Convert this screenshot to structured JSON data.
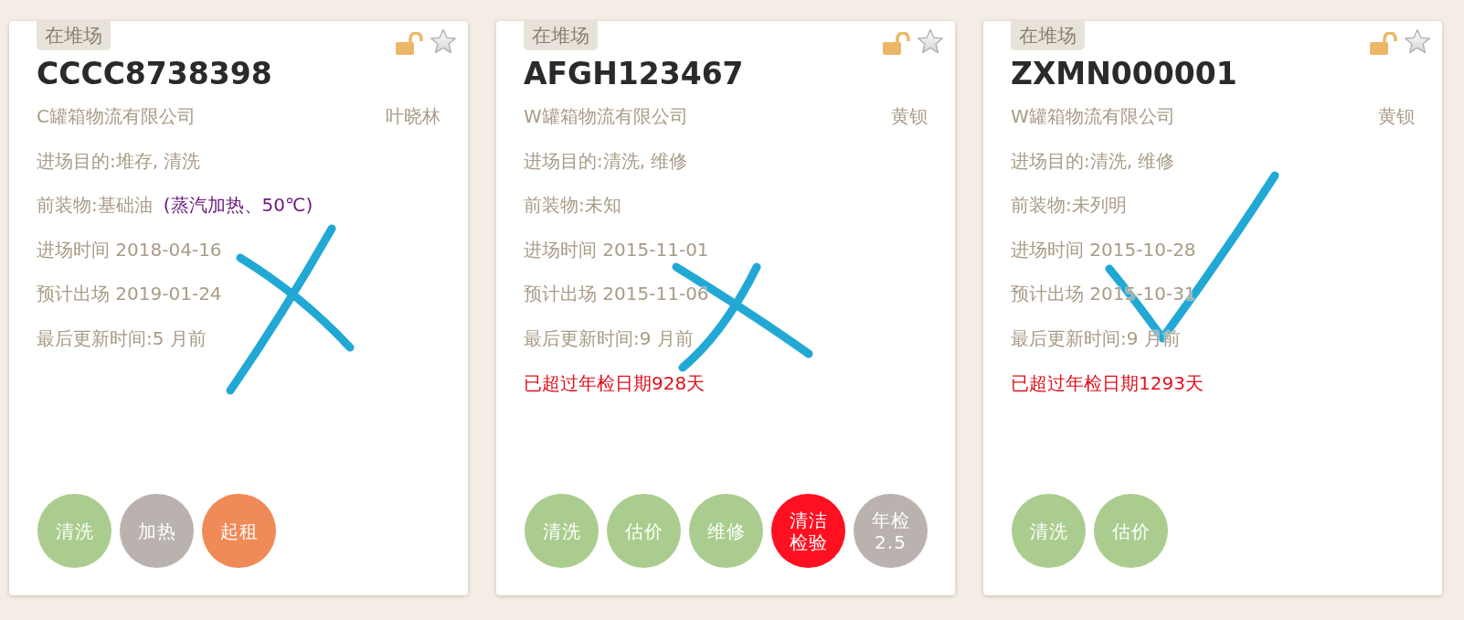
{
  "cards": [
    {
      "status": "在堆场",
      "container_no": "CCCC8738398",
      "company": "C罐箱物流有限公司",
      "contact": "叶晓林",
      "purpose": "进场目的:堆存, 清洗",
      "cargo": {
        "text": "前装物:基础油",
        "note": "(蒸汽加热、50℃)"
      },
      "entry": "进场时间 2018-04-16",
      "exit": "预计出场 2019-01-24",
      "updated": "最后更新时间:5 月前",
      "annotation": {
        "kind": "cross"
      },
      "actions": [
        {
          "label": "清洗",
          "color": "#aacd8f"
        },
        {
          "label": "加热",
          "color": "#b9b2ae"
        },
        {
          "label": "起租",
          "color": "#f08a58"
        }
      ]
    },
    {
      "status": "在堆场",
      "container_no": "AFGH123467",
      "company": "W罐箱物流有限公司",
      "contact": "黄钡",
      "purpose": "进场目的:清洗, 维修",
      "cargo": {
        "text": "前装物:未知"
      },
      "entry": "进场时间 2015-11-01",
      "exit": "预计出场 2015-11-06",
      "updated": "最后更新时间:9 月前",
      "warning": "已超过年检日期928天",
      "annotation": {
        "kind": "cross"
      },
      "actions": [
        {
          "label": "清洗",
          "color": "#aacd8f"
        },
        {
          "label": "估价",
          "color": "#aacd8f"
        },
        {
          "label": "维修",
          "color": "#aacd8f"
        },
        {
          "label": "清洁检验",
          "color": "#ff1020"
        },
        {
          "label": "年检\n2.5",
          "color": "#b9b2ae"
        }
      ]
    },
    {
      "status": "在堆场",
      "container_no": "ZXMN000001",
      "company": "W罐箱物流有限公司",
      "contact": "黄钡",
      "purpose": "进场目的:清洗, 维修",
      "cargo": {
        "text": "前装物:未列明"
      },
      "entry": "进场时间 2015-10-28",
      "exit": "预计出场 2015-10-31",
      "updated": "最后更新时间:9 月前",
      "warning": "已超过年检日期1293天",
      "annotation": {
        "kind": "check"
      },
      "actions": [
        {
          "label": "清洗",
          "color": "#aacd8f"
        },
        {
          "label": "估价",
          "color": "#aacd8f"
        }
      ]
    }
  ]
}
